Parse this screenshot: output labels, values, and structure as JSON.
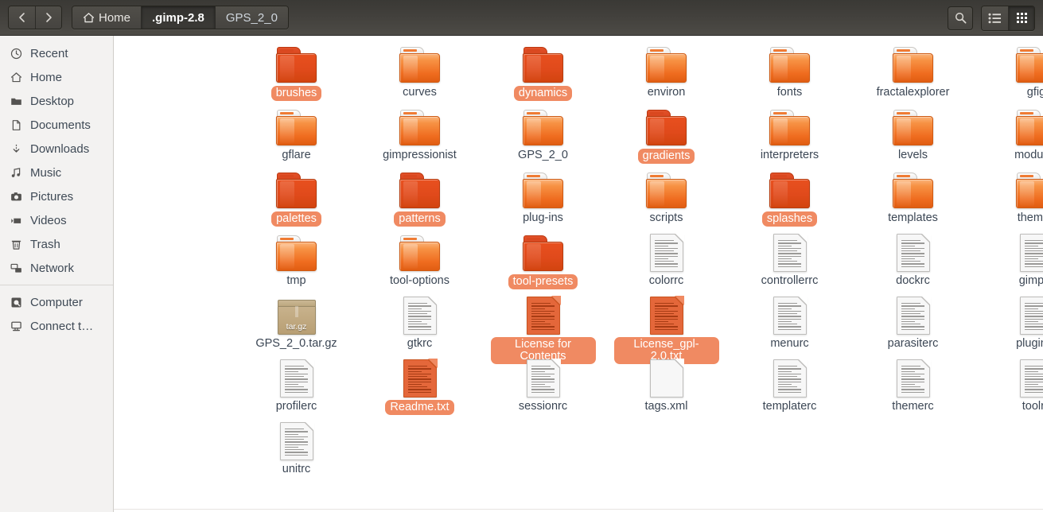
{
  "header": {
    "nav": {
      "back_label": "‹",
      "forward_label": "›",
      "back_name": "Back",
      "forward_name": "Forward"
    },
    "breadcrumbs": [
      {
        "label": "Home",
        "icon": "home-icon",
        "active": false,
        "dim": false
      },
      {
        "label": ".gimp-2.8",
        "icon": "",
        "active": true,
        "dim": false
      },
      {
        "label": "GPS_2_0",
        "icon": "",
        "active": false,
        "dim": true
      }
    ],
    "actions": [
      {
        "name": "search-icon",
        "label": "Search"
      },
      {
        "name": "list-view-icon",
        "label": "List view",
        "active": false
      },
      {
        "name": "grid-view-icon",
        "label": "Grid view",
        "active": true
      }
    ]
  },
  "sidebar": {
    "items": [
      {
        "label": "Recent",
        "icon": "clock-icon"
      },
      {
        "label": "Home",
        "icon": "home-icon"
      },
      {
        "label": "Desktop",
        "icon": "desktop-folder-icon"
      },
      {
        "label": "Documents",
        "icon": "document-icon"
      },
      {
        "label": "Downloads",
        "icon": "download-icon"
      },
      {
        "label": "Music",
        "icon": "music-note-icon"
      },
      {
        "label": "Pictures",
        "icon": "camera-icon"
      },
      {
        "label": "Videos",
        "icon": "video-camera-icon"
      },
      {
        "label": "Trash",
        "icon": "trash-icon"
      },
      {
        "label": "Network",
        "icon": "network-icon"
      }
    ],
    "items2": [
      {
        "label": "Computer",
        "icon": "harddisk-icon"
      },
      {
        "label": "Connect t…",
        "icon": "connect-server-icon"
      }
    ]
  },
  "colors": {
    "selection_pill": "#f08a62",
    "selected_folder": "#e04a1b",
    "folder_orange": "#ef6c1f",
    "header_dark": "#43413d",
    "sidebar_bg": "#f3f2f1",
    "label_text": "#3b4654"
  },
  "files": [
    {
      "name": "brushes",
      "type": "folder",
      "selected": true
    },
    {
      "name": "curves",
      "type": "folder",
      "selected": false
    },
    {
      "name": "dynamics",
      "type": "folder",
      "selected": true
    },
    {
      "name": "environ",
      "type": "folder",
      "selected": false
    },
    {
      "name": "fonts",
      "type": "folder",
      "selected": false
    },
    {
      "name": "fractalexplorer",
      "type": "folder",
      "selected": false
    },
    {
      "name": "gfig",
      "type": "folder",
      "selected": false
    },
    {
      "name": "gflare",
      "type": "folder",
      "selected": false
    },
    {
      "name": "gimpressionist",
      "type": "folder",
      "selected": false
    },
    {
      "name": "GPS_2_0",
      "type": "folder",
      "selected": false
    },
    {
      "name": "gradients",
      "type": "folder",
      "selected": true
    },
    {
      "name": "interpreters",
      "type": "folder",
      "selected": false
    },
    {
      "name": "levels",
      "type": "folder",
      "selected": false
    },
    {
      "name": "modules",
      "type": "folder",
      "selected": false
    },
    {
      "name": "palettes",
      "type": "folder",
      "selected": true
    },
    {
      "name": "patterns",
      "type": "folder",
      "selected": true
    },
    {
      "name": "plug-ins",
      "type": "folder",
      "selected": false
    },
    {
      "name": "scripts",
      "type": "folder",
      "selected": false
    },
    {
      "name": "splashes",
      "type": "folder",
      "selected": true
    },
    {
      "name": "templates",
      "type": "folder",
      "selected": false
    },
    {
      "name": "themes",
      "type": "folder",
      "selected": false
    },
    {
      "name": "tmp",
      "type": "folder",
      "selected": false
    },
    {
      "name": "tool-options",
      "type": "folder",
      "selected": false
    },
    {
      "name": "tool-presets",
      "type": "folder",
      "selected": true
    },
    {
      "name": "colorrc",
      "type": "document",
      "selected": false
    },
    {
      "name": "controllerrc",
      "type": "document",
      "selected": false
    },
    {
      "name": "dockrc",
      "type": "document",
      "selected": false
    },
    {
      "name": "gimprc",
      "type": "document",
      "selected": false
    },
    {
      "name": "GPS_2_0.tar.gz",
      "type": "archive",
      "selected": false,
      "badge": "tar.gz"
    },
    {
      "name": "gtkrc",
      "type": "document",
      "selected": false
    },
    {
      "name": "License for Contents",
      "type": "document",
      "selected": true
    },
    {
      "name": "License_gpl-2.0.txt",
      "type": "document",
      "selected": true
    },
    {
      "name": "menurc",
      "type": "document",
      "selected": false
    },
    {
      "name": "parasiterc",
      "type": "document",
      "selected": false
    },
    {
      "name": "pluginrc",
      "type": "document",
      "selected": false
    },
    {
      "name": "profilerc",
      "type": "document",
      "selected": false
    },
    {
      "name": "Readme.txt",
      "type": "document",
      "selected": true
    },
    {
      "name": "sessionrc",
      "type": "document",
      "selected": false
    },
    {
      "name": "tags.xml",
      "type": "code",
      "selected": false,
      "glyph": "</>"
    },
    {
      "name": "templaterc",
      "type": "document",
      "selected": false
    },
    {
      "name": "themerc",
      "type": "document",
      "selected": false
    },
    {
      "name": "toolrc",
      "type": "document",
      "selected": false
    },
    {
      "name": "unitrc",
      "type": "document",
      "selected": false
    }
  ]
}
